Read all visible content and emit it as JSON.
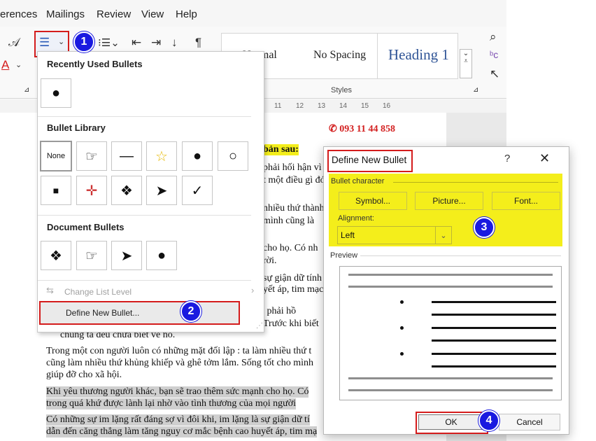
{
  "ribbon": {
    "tabs": [
      "erences",
      "Mailings",
      "Review",
      "View",
      "Help"
    ],
    "styles": {
      "normal_label": "Normal",
      "no_spacing_label": "No Spacing",
      "heading1_label": "Heading 1",
      "group_label": "Styles"
    }
  },
  "ruler": {
    "ticks": [
      "11",
      "12",
      "13",
      "14",
      "15",
      "16"
    ]
  },
  "document": {
    "phone": "093 11 44 858",
    "heading_fragment": "bản sau:",
    "right_fragments": [
      "phải hối hận vì g",
      "t một điều gì đó",
      "nhiều thứ thành",
      "mình cũng là",
      "cho họ. Có nh",
      "rời.",
      "sự giận dữ tính",
      "yết áp, tim mạch",
      "không phải hồ",
      "Trước khi biết"
    ],
    "lines": [
      "chúng ta đều chưa biết về nó.",
      "Trong một con người luôn có những mặt đối lập : ta làm nhiều thứ t",
      "cũng làm nhiều thứ khủng khiếp và ghê tởm lắm. Sống tốt cho mình",
      "giúp đỡ cho xã hội.",
      "Khi yêu thương người khác, bạn sẽ trao thêm sức mạnh cho họ. Có",
      "trong quá khứ được lành lại nhờ vào tình thương của mọi người",
      "Có những sự im lặng rất đáng sợ vì đôi khi, im lặng là sự giận dữ tí",
      "dẫn đến căng thẳng làm tăng nguy cơ mắc bệnh cao huyết áp, tim mạ"
    ]
  },
  "bullet_menu": {
    "recent_heading": "Recently Used Bullets",
    "library_heading": "Bullet Library",
    "document_heading": "Document Bullets",
    "none_label": "None",
    "recent_bullets": [
      "●"
    ],
    "library_bullets": [
      "☞",
      "—",
      "☆",
      "●",
      "○",
      "■",
      "✛",
      "❖",
      "➤",
      "✓"
    ],
    "document_bullets": [
      "❖",
      "☞",
      "➤",
      "●"
    ],
    "change_list_level": "Change List Level",
    "define_new_bullet": "Define New Bullet..."
  },
  "dialog": {
    "title": "Define New Bullet",
    "help": "?",
    "close": "✕",
    "bullet_character_label": "Bullet character",
    "symbol_button": "Symbol...",
    "picture_button": "Picture...",
    "font_button": "Font...",
    "alignment_label": "Alignment:",
    "alignment_value": "Left",
    "preview_label": "Preview",
    "ok_button": "OK",
    "cancel_button": "Cancel"
  },
  "callouts": [
    "1",
    "2",
    "3",
    "4"
  ],
  "colors": {
    "highlight_red": "#d41c1c",
    "callout_blue": "#1a1ae0",
    "yellow_highlight": "#f4ee1b",
    "phone_red": "#d32020"
  }
}
